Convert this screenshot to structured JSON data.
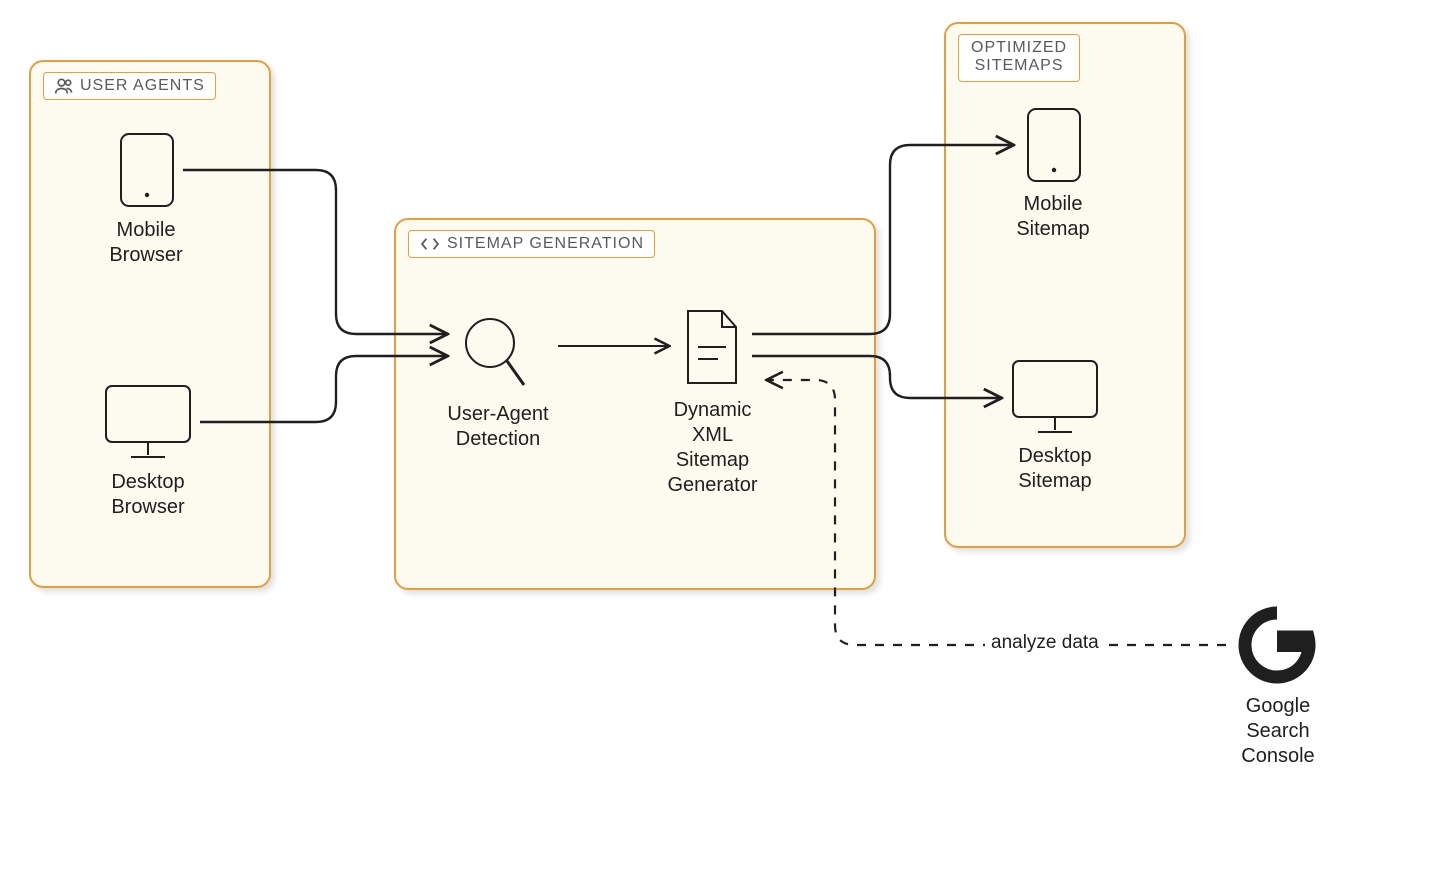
{
  "groups": {
    "userAgents": {
      "label": "USER AGENTS"
    },
    "sitemapGeneration": {
      "label": "SITEMAP GENERATION"
    },
    "optimizedSitemaps": {
      "label": "OPTIMIZED\nSITEMAPS"
    }
  },
  "nodes": {
    "mobileBrowser": {
      "label": "Mobile\nBrowser"
    },
    "desktopBrowser": {
      "label": "Desktop\nBrowser"
    },
    "uaDetection": {
      "label": "User-Agent\nDetection"
    },
    "xmlGenerator": {
      "label": "Dynamic\nXML\nSitemap\nGenerator"
    },
    "mobileSitemap": {
      "label": "Mobile\nSitemap"
    },
    "desktopSitemap": {
      "label": "Desktop\nSitemap"
    },
    "googleSearchConsole": {
      "label": "Google\nSearch\nConsole"
    }
  },
  "edges": {
    "analyzeData": {
      "label": "analyze data"
    }
  }
}
